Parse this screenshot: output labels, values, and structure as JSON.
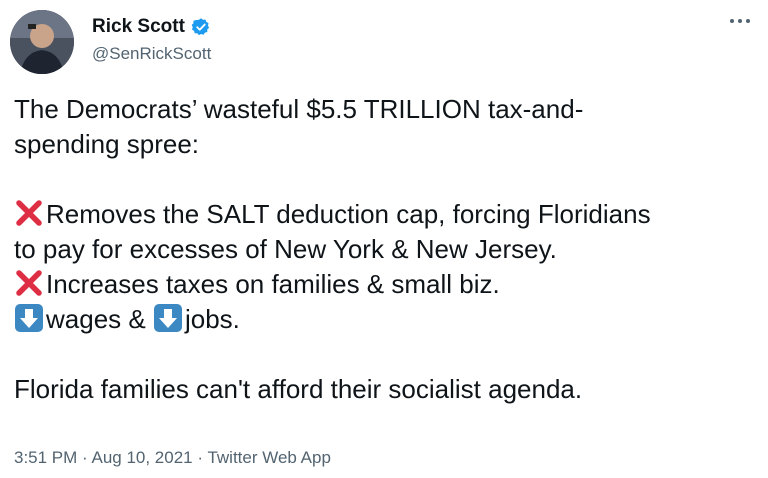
{
  "author": {
    "name": "Rick Scott",
    "handle": "@SenRickScott",
    "verified": true
  },
  "icons": {
    "verified": "verified-badge-icon",
    "more": "more-options-icon",
    "cross": "red-cross-mark-icon",
    "down_arrow": "down-arrow-icon"
  },
  "colors": {
    "verified_blue": "#1d9bf0",
    "cross_red": "#dd2e44",
    "arrow_box_blue": "#3b88c3",
    "meta_gray": "#536471"
  },
  "tweet": {
    "line1": "The Democrats’ wasteful $5.5 TRILLION tax-and-",
    "line2": "spending spree:",
    "line3": "Removes the SALT deduction cap, forcing Floridians",
    "line4": "to pay for excesses of New York & New Jersey.",
    "line5": "Increases taxes on families & small biz.",
    "line6a": "wages & ",
    "line6b": "jobs.",
    "line7": "Florida families can't afford their socialist agenda."
  },
  "meta": {
    "time": "3:51 PM",
    "sep1": " · ",
    "date": "Aug 10, 2021",
    "sep2": " · ",
    "source": "Twitter Web App"
  }
}
